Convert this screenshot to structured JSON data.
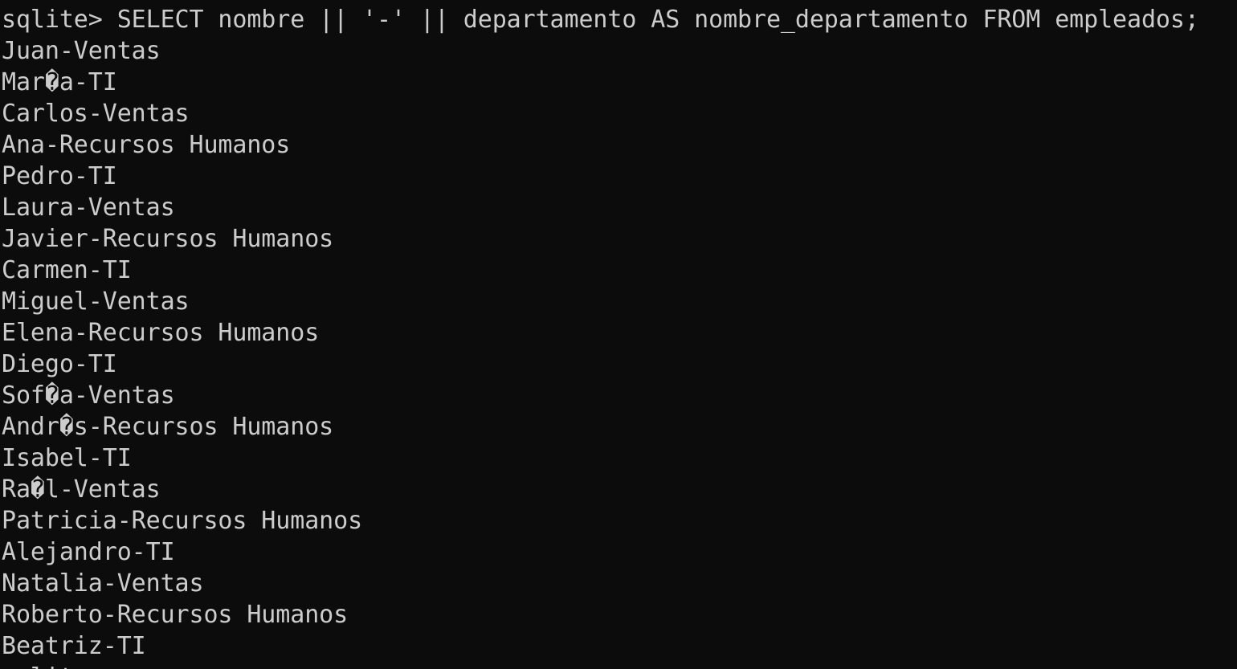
{
  "terminal": {
    "command_line": "sqlite> SELECT nombre || '-' || departamento AS nombre_departamento FROM empleados;",
    "results": [
      "Juan-Ventas",
      "Mar�a-TI",
      "Carlos-Ventas",
      "Ana-Recursos Humanos",
      "Pedro-TI",
      "Laura-Ventas",
      "Javier-Recursos Humanos",
      "Carmen-TI",
      "Miguel-Ventas",
      "Elena-Recursos Humanos",
      "Diego-TI",
      "Sof�a-Ventas",
      "Andr�s-Recursos Humanos",
      "Isabel-TI",
      "Ra�l-Ventas",
      "Patricia-Recursos Humanos",
      "Alejandro-TI",
      "Natalia-Ventas",
      "Roberto-Recursos Humanos",
      "Beatriz-TI"
    ],
    "next_prompt": "sqlite>",
    "colors": {
      "background": "#0c0c0c",
      "foreground": "#cccccc"
    }
  }
}
